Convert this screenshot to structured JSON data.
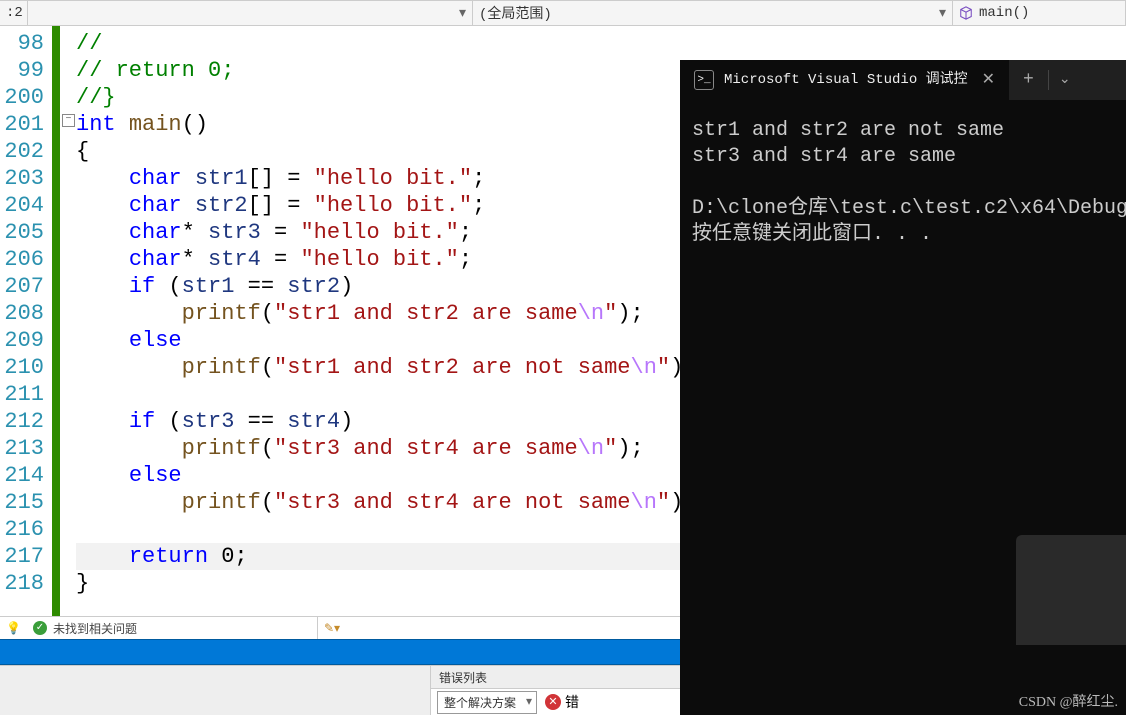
{
  "topbar": {
    "file_suffix": ":2",
    "scope": "(全局范围)",
    "function": "main()"
  },
  "gutter": [
    "98",
    "99",
    "200",
    "201",
    "202",
    "203",
    "204",
    "205",
    "206",
    "207",
    "208",
    "209",
    "210",
    "211",
    "212",
    "213",
    "214",
    "215",
    "216",
    "217",
    "218"
  ],
  "code": {
    "l0": {
      "cm": "//"
    },
    "l1": {
      "cm": "// return 0;"
    },
    "l2": {
      "cm": "//}"
    },
    "l3": {
      "kw": "int",
      "fn": "main",
      "rest": "()"
    },
    "l4": {
      "txt": "{"
    },
    "l5": {
      "kw": "char",
      "id": "str1",
      "br": "[] = ",
      "st": "\"hello bit.\"",
      "end": ";"
    },
    "l6": {
      "kw": "char",
      "id": "str2",
      "br": "[] = ",
      "st": "\"hello bit.\"",
      "end": ";"
    },
    "l7": {
      "kw": "char",
      "star": "*",
      "id": "str3",
      "eq": " = ",
      "st": "\"hello bit.\"",
      "end": ";"
    },
    "l8": {
      "kw": "char",
      "star": "*",
      "id": "str4",
      "eq": " = ",
      "st": "\"hello bit.\"",
      "end": ";"
    },
    "l9": {
      "kw": "if",
      "a": "str1",
      "op": "==",
      "b": "str2"
    },
    "l10": {
      "fn": "printf",
      "st": "\"str1 and str2 are same",
      "es": "\\n",
      "ste": "\"",
      "end": ");"
    },
    "l11": {
      "kw": "else"
    },
    "l12": {
      "fn": "printf",
      "st": "\"str1 and str2 are not same",
      "es": "\\n",
      "ste": "\"",
      "end": ");"
    },
    "l13": {
      "txt": ""
    },
    "l14": {
      "kw": "if",
      "a": "str3",
      "op": "==",
      "b": "str4"
    },
    "l15": {
      "fn": "printf",
      "st": "\"str3 and str4 are same",
      "es": "\\n",
      "ste": "\"",
      "end": ");"
    },
    "l16": {
      "kw": "else"
    },
    "l17": {
      "fn": "printf",
      "st": "\"str3 and str4 are not same",
      "es": "\\n",
      "ste": "\"",
      "end": ");"
    },
    "l18": {
      "txt": ""
    },
    "l19": {
      "kw": "return",
      "val": "0",
      "end": ";"
    },
    "l20": {
      "txt": "}"
    }
  },
  "status": {
    "msg": "未找到相关问题"
  },
  "bluebar": {
    "pin": "📌",
    "close": "✕"
  },
  "errlist": {
    "title": "错误列表",
    "scope": "整个解决方案",
    "err_label": "错"
  },
  "console": {
    "title": "Microsoft Visual Studio 调试控",
    "lines": [
      "str1 and str2 are not same",
      "str3 and str4 are same",
      "",
      "D:\\clone仓库\\test.c\\test.c2\\x64\\Debug",
      "按任意键关闭此窗口. . ."
    ]
  },
  "watermark": "CSDN @醉红尘."
}
